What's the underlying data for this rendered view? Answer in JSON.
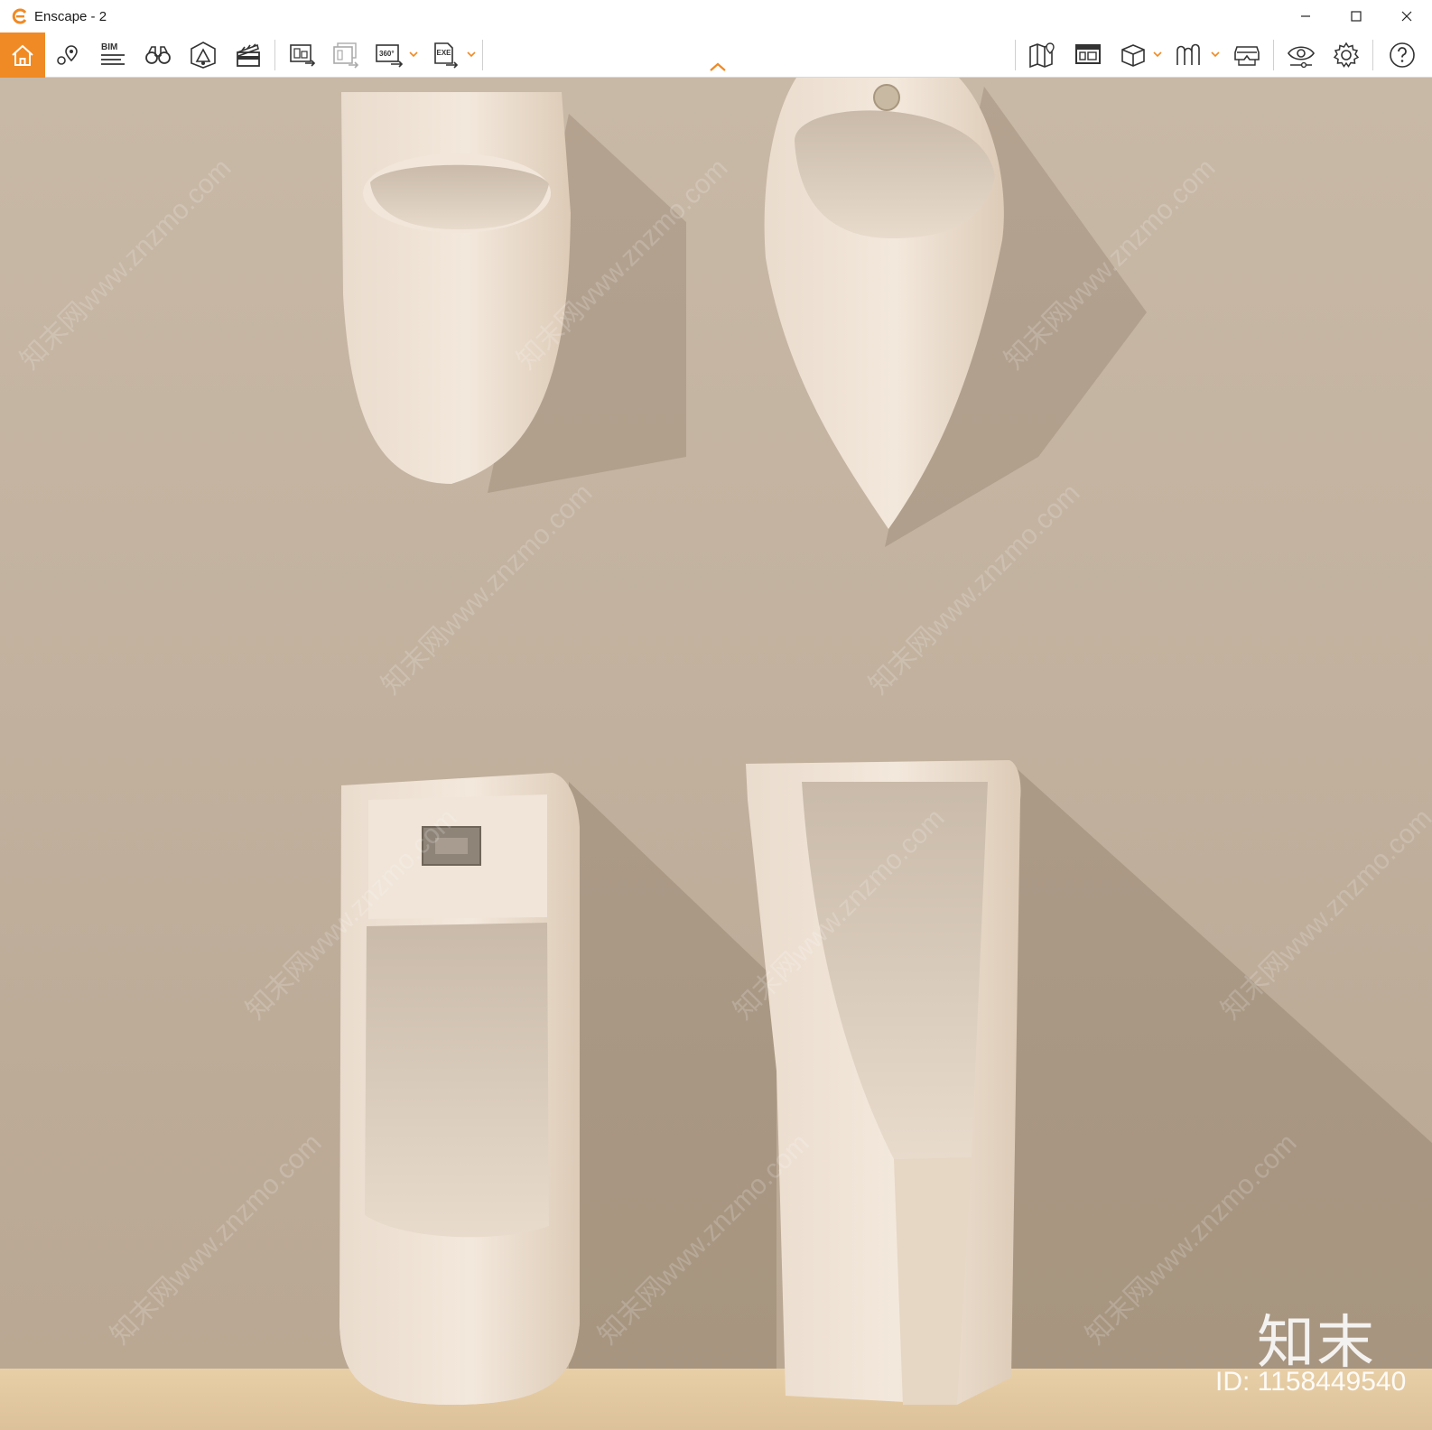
{
  "window": {
    "title": "Enscape - 2",
    "minimize_icon": "minimize-icon",
    "maximize_icon": "maximize-icon",
    "close_icon": "close-icon"
  },
  "toolbar": {
    "accent_color": "#f08a24",
    "bim_label": "BIM",
    "panorama_label": "360°",
    "exe_label": "EXE",
    "left_tools": [
      "home-icon",
      "location-pin-icon",
      "bim-info-icon",
      "binoculars-icon",
      "sun-house-icon",
      "clapperboard-icon",
      "screenshot-export-icon",
      "batch-render-icon",
      "panorama-360-icon",
      "exe-export-icon"
    ],
    "right_tools": [
      "map-icon",
      "minimap-icon",
      "cube-view-icon",
      "asset-library-icon",
      "vr-headset-icon",
      "visual-settings-icon",
      "settings-gear-icon",
      "help-icon"
    ]
  },
  "watermark": {
    "logo_text": "知末",
    "id_text": "ID: 1158449540",
    "url_text": "知末网www.znzmo.com"
  }
}
